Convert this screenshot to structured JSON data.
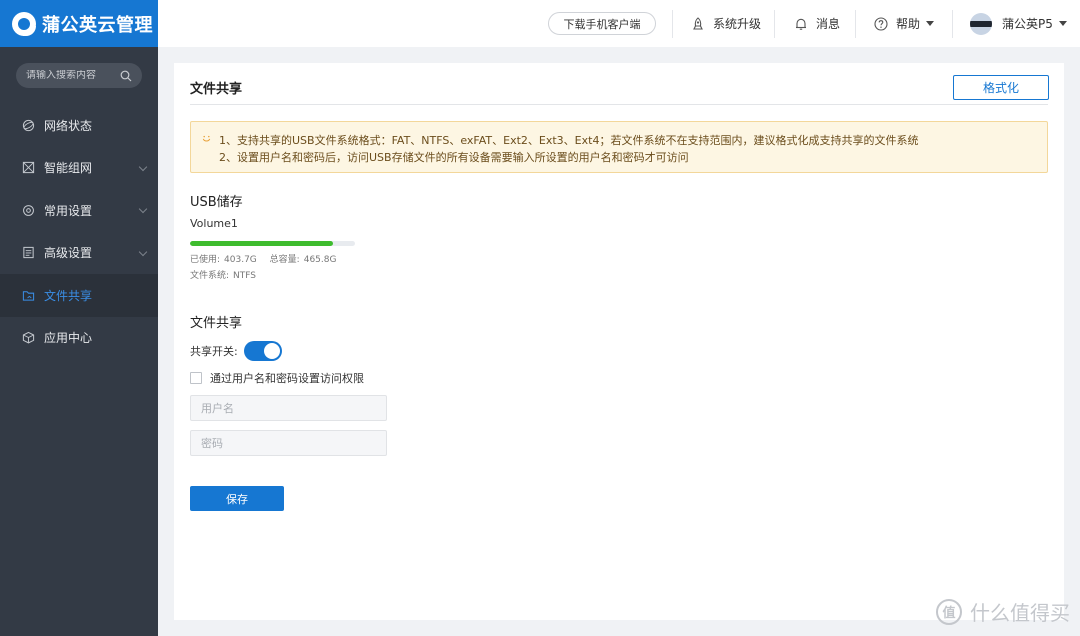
{
  "app": {
    "title": "蒲公英云管理"
  },
  "sidebar": {
    "search_placeholder": "请输入搜索内容",
    "items": [
      {
        "label": "网络状态",
        "icon": "globe-icon",
        "has_submenu": false
      },
      {
        "label": "智能组网",
        "icon": "network-icon",
        "has_submenu": true
      },
      {
        "label": "常用设置",
        "icon": "gear-icon",
        "has_submenu": true
      },
      {
        "label": "高级设置",
        "icon": "document-icon",
        "has_submenu": true
      },
      {
        "label": "文件共享",
        "icon": "folder-icon",
        "has_submenu": false,
        "active": true
      },
      {
        "label": "应用中心",
        "icon": "cube-icon",
        "has_submenu": false
      }
    ]
  },
  "topbar": {
    "download_client": "下载手机客户端",
    "upgrade": "系统升级",
    "messages": "消息",
    "help": "帮助",
    "user": "蒲公英P5"
  },
  "page": {
    "title": "文件共享",
    "format_button": "格式化",
    "notice": {
      "line1": "1、支持共享的USB文件系统格式：FAT、NTFS、exFAT、Ext2、Ext3、Ext4；若文件系统不在支持范围内，建议格式化成支持共享的文件系统",
      "line2": "2、设置用户名和密码后，访问USB存储文件的所有设备需要输入所设置的用户名和密码才可访问"
    },
    "usb": {
      "section_title": "USB储存",
      "volume": "Volume1",
      "used_label": "已使用:",
      "used": "403.7G",
      "total_label": "总容量:",
      "total": "465.8G",
      "fs_label": "文件系统:",
      "fs": "NTFS",
      "usage_fraction": 0.867
    },
    "share": {
      "section_title": "文件共享",
      "toggle_label": "共享开关:",
      "toggle_on": true,
      "auth_checkbox_label": "通过用户名和密码设置访问权限",
      "auth_checked": false,
      "username_placeholder": "用户名",
      "password_placeholder": "密码",
      "save_button": "保存"
    }
  },
  "colors": {
    "brand": "#1677d2",
    "sidebar": "#333a45",
    "progress": "#3ebc2e"
  },
  "watermark": {
    "text": "什么值得买",
    "logo": "值"
  }
}
